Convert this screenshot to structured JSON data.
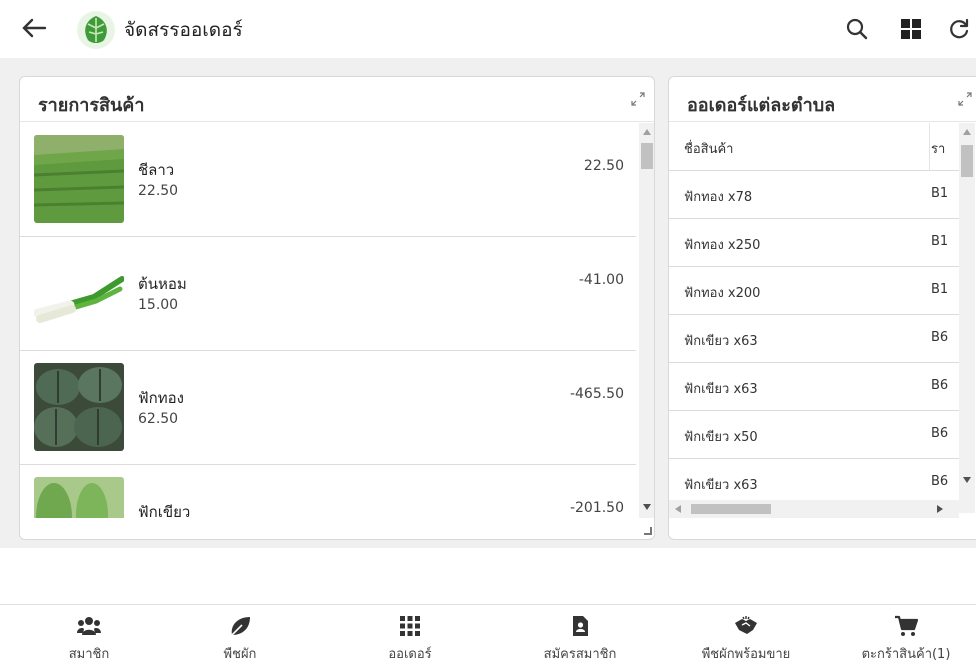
{
  "app": {
    "title": "จัดสรรออเดอร์",
    "back_icon": "arrow-left-icon",
    "logo_icon": "vegetable-logo-icon",
    "actions": [
      "search-icon",
      "grid-view-icon",
      "refresh-icon"
    ]
  },
  "products_panel": {
    "title": "รายการสินค้า",
    "items": [
      {
        "name": "ชีลาว",
        "price": "22.50",
        "amount": "22.50",
        "image": "dill-field-image"
      },
      {
        "name": "ต้นหอม",
        "price": "15.00",
        "amount": "-41.00",
        "image": "spring-onion-image"
      },
      {
        "name": "ฟักทอง",
        "price": "62.50",
        "amount": "-465.50",
        "image": "pumpkin-image"
      },
      {
        "name": "ฟักเขียว",
        "price": "",
        "amount": "-201.50",
        "image": "winter-melon-image"
      }
    ]
  },
  "orders_panel": {
    "title": "ออเดอร์แต่ละตำบล",
    "columns": [
      "ชื่อสินค้า",
      "รา"
    ],
    "rows": [
      {
        "product": "ฟักทอง x78",
        "code": "B1"
      },
      {
        "product": "ฟักทอง x250",
        "code": "B1"
      },
      {
        "product": "ฟักทอง x200",
        "code": "B1"
      },
      {
        "product": "ฟักเขียว x63",
        "code": "B6"
      },
      {
        "product": "ฟักเขียว x63",
        "code": "B6"
      },
      {
        "product": "ฟักเขียว x50",
        "code": "B6"
      },
      {
        "product": "ฟักเขียว x63",
        "code": "B6"
      }
    ]
  },
  "bottom_nav": [
    {
      "label": "สมาชิก",
      "icon": "users-icon"
    },
    {
      "label": "พืชผัก",
      "icon": "leaf-icon"
    },
    {
      "label": "ออเดอร์",
      "icon": "grid-icon"
    },
    {
      "label": "สมัครสมาชิก",
      "icon": "id-card-icon"
    },
    {
      "label": "พืชผักพร้อมขาย",
      "icon": "handshake-icon"
    },
    {
      "label": "ตะกร้าสินค้า(1)",
      "icon": "cart-icon"
    }
  ],
  "colors": {
    "accent": "#2e9a3c",
    "icon": "#333333",
    "background": "#f0f0f0"
  }
}
